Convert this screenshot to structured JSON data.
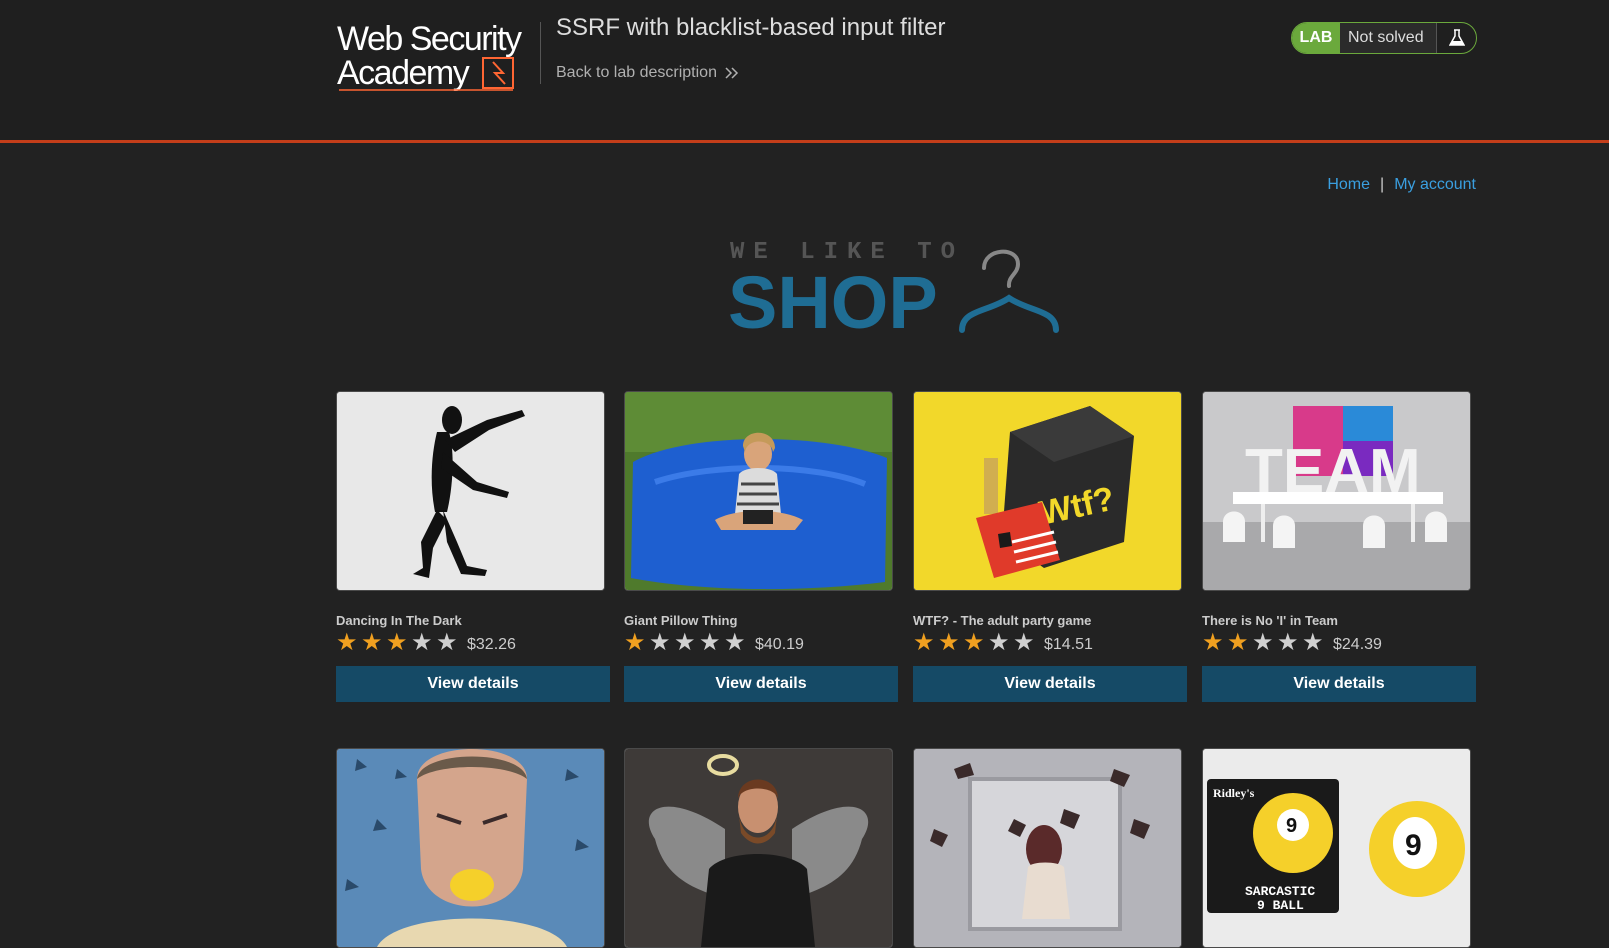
{
  "lab": {
    "title": "SSRF with blacklist-based input filter",
    "back_link": "Back to lab description",
    "badge": "LAB",
    "status": "Not solved"
  },
  "logo": {
    "line1": "Web Security",
    "line2": "Academy"
  },
  "nav": {
    "home": "Home",
    "separator": "|",
    "account": "My account"
  },
  "hero": {
    "tagline": "WE LIKE TO",
    "word": "SHOP"
  },
  "products": [
    {
      "name": "Dancing In The Dark",
      "rating": 3,
      "price": "$32.26",
      "button": "View details",
      "image": "silhouette-dancer"
    },
    {
      "name": "Giant Pillow Thing",
      "rating": 1,
      "price": "$40.19",
      "button": "View details",
      "image": "girl-on-blue-beanbag"
    },
    {
      "name": "WTF? - The adult party game",
      "rating": 3,
      "price": "$14.51",
      "button": "View details",
      "image": "wtf-game-box"
    },
    {
      "name": "There is No 'I' in Team",
      "rating": 2,
      "price": "$24.39",
      "button": "View details",
      "image": "team-letters-office"
    },
    {
      "name": "",
      "rating": 0,
      "price": "",
      "button": "",
      "image": "man-biting-lemon"
    },
    {
      "name": "",
      "rating": 0,
      "price": "",
      "button": "",
      "image": "bearded-man-angel-wings"
    },
    {
      "name": "",
      "rating": 0,
      "price": "",
      "button": "",
      "image": "woman-flying-books"
    },
    {
      "name": "",
      "rating": 0,
      "price": "",
      "button": "",
      "image": "sarcastic-9-ball"
    }
  ],
  "images_text": {
    "wtf": "Wtf?",
    "team": "TEAM",
    "ball_brand": "Ridley's",
    "ball_line1": "SARCASTIC",
    "ball_line2": "9 BALL",
    "ball_number": "9"
  },
  "colors": {
    "accent_blue": "#3a9fe0",
    "button_blue": "#154a66",
    "lab_green": "#6ba93c",
    "header_rule": "#c43e1a",
    "star_on": "#f0a020",
    "hero_blue": "#1f6d94"
  }
}
